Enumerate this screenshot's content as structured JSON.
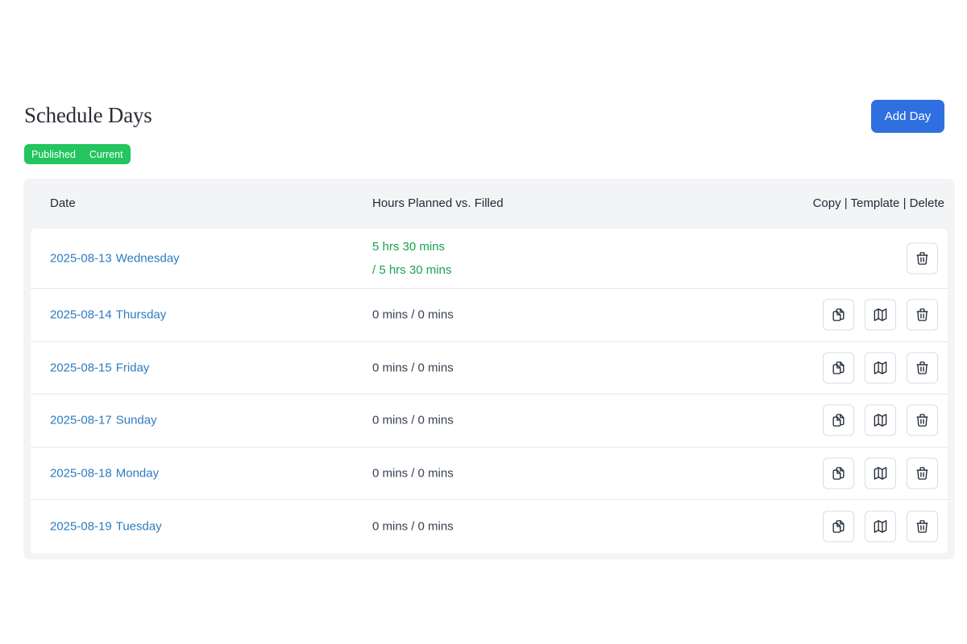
{
  "header": {
    "title": "Schedule Days",
    "add_button_label": "Add Day",
    "badge": {
      "status": "Published",
      "state": "Current",
      "color": "#22c55e"
    }
  },
  "table": {
    "columns": {
      "date": "Date",
      "hours": "Hours Planned vs. Filled",
      "actions": "Copy | Template | Delete"
    },
    "rows": [
      {
        "date": "2025-08-13",
        "weekday": "Wednesday",
        "planned": "5 hrs 30 mins",
        "filled": "/ 5 hrs 30 mins",
        "actions": [
          "trash-icon"
        ]
      },
      {
        "date": "2025-08-14",
        "weekday": "Thursday",
        "planned": "0 mins",
        "filled": "/ 0 mins",
        "actions": [
          "copy-icon",
          "map-icon",
          "trash-icon"
        ]
      },
      {
        "date": "2025-08-15",
        "weekday": "Friday",
        "planned": "0 mins",
        "filled": "/ 0 mins",
        "actions": [
          "copy-icon",
          "map-icon",
          "trash-icon"
        ]
      },
      {
        "date": "2025-08-17",
        "weekday": "Sunday",
        "planned": "0 mins",
        "filled": "/ 0 mins",
        "actions": [
          "copy-icon",
          "map-icon",
          "trash-icon"
        ]
      },
      {
        "date": "2025-08-18",
        "weekday": "Monday",
        "planned": "0 mins",
        "filled": "/ 0 mins",
        "actions": [
          "copy-icon",
          "map-icon",
          "trash-icon"
        ]
      },
      {
        "date": "2025-08-19",
        "weekday": "Tuesday",
        "planned": "0 mins",
        "filled": "/ 0 mins",
        "actions": [
          "copy-icon",
          "map-icon",
          "trash-icon"
        ]
      }
    ]
  },
  "colors": {
    "accent": "#2f6fe0",
    "link": "#2e7bbf",
    "filled_text": "#16a34a"
  }
}
